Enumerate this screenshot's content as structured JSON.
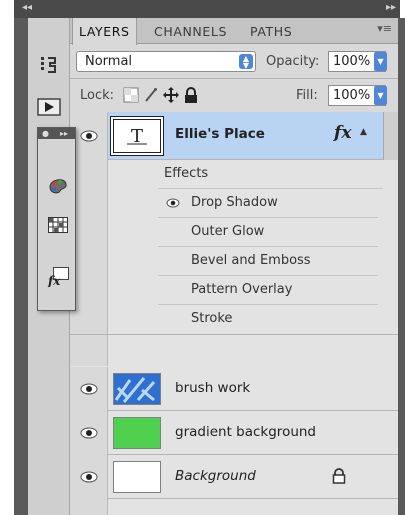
{
  "window": {
    "collapse_left_glyph": "◂◂",
    "collapse_right_glyph": "▸▸"
  },
  "tabs": [
    {
      "label": "LAYERS",
      "active": true
    },
    {
      "label": "CHANNELS",
      "active": false
    },
    {
      "label": "PATHS",
      "active": false
    }
  ],
  "panel_menu_glyph": "▾≡",
  "blend_mode": {
    "value": "Normal"
  },
  "opacity": {
    "label": "Opacity:",
    "value": "100%"
  },
  "lock": {
    "label": "Lock:"
  },
  "fill": {
    "label": "Fill:",
    "value": "100%"
  },
  "layers": [
    {
      "name": "Ellie's Place",
      "type": "text",
      "selected": true,
      "fx_label": "fx",
      "effects_header": "Effects",
      "effects": [
        {
          "name": "Drop Shadow",
          "visible": true
        },
        {
          "name": "Outer Glow",
          "visible": false
        },
        {
          "name": "Bevel and Emboss",
          "visible": false
        },
        {
          "name": "Pattern Overlay",
          "visible": false
        },
        {
          "name": "Stroke",
          "visible": false
        }
      ]
    },
    {
      "name": "brush work",
      "visible": true,
      "thumb_color": "#2f6fd0"
    },
    {
      "name": "gradient background",
      "visible": true,
      "thumb_color": "#4fd14f"
    },
    {
      "name": "Background",
      "visible": true,
      "italic": true,
      "locked": true,
      "thumb_color": "#ffffff"
    }
  ],
  "colors": {
    "selected_row": "#b9d3f3",
    "accent_blue": "#4f87d6",
    "panel_bg": "#d9d9d9"
  },
  "tool_icons": [
    "history-icon",
    "actions-play-icon"
  ],
  "mini_palette_icons": [
    "styles-palette-icon",
    "swatches-grid-icon",
    "fx-effects-icon"
  ]
}
